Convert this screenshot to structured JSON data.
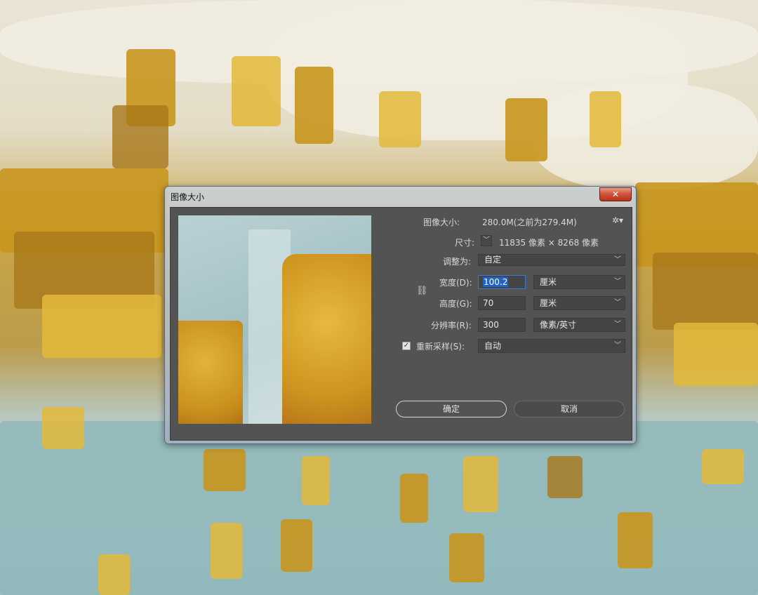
{
  "dialog": {
    "title": "图像大小",
    "close_glyph": "✕"
  },
  "info": {
    "image_size_label": "图像大小:",
    "image_size_value": "280.0M(之前为279.4M)",
    "dimensions_label": "尺寸:",
    "dimensions_value": "11835 像素 × 8268 像素",
    "gear_icon": "gear-icon"
  },
  "fit": {
    "label": "调整为:",
    "value": "自定"
  },
  "width": {
    "label": "宽度(D):",
    "value": "100.2",
    "unit": "厘米"
  },
  "height": {
    "label": "高度(G):",
    "value": "70",
    "unit": "厘米"
  },
  "resolution": {
    "label": "分辨率(R):",
    "value": "300",
    "unit": "像素/英寸"
  },
  "resample": {
    "label": "重新采样(S):",
    "checked": true,
    "value": "自动"
  },
  "buttons": {
    "ok": "确定",
    "cancel": "取消"
  },
  "colors": {
    "client_bg": "#535353",
    "field_bg": "#454545",
    "focus": "#3d7ad8",
    "close_red": "#c8432a"
  }
}
